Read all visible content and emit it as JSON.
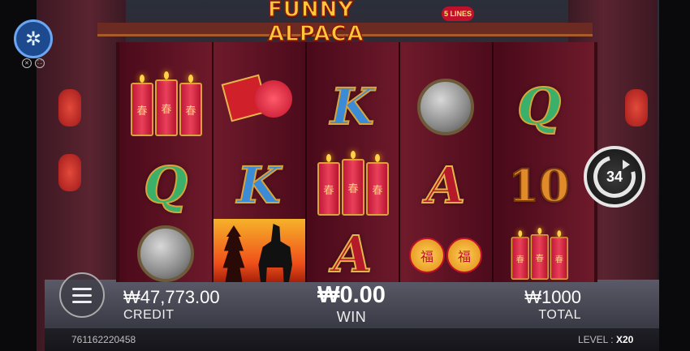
{
  "logo": {
    "title": "FUNNY ALPACA",
    "lines_badge": "5 LINES"
  },
  "controls": {
    "settings_icon": "wheel-icon",
    "spin_count": "34",
    "menu_icon": "menu-icon"
  },
  "reels": [
    {
      "reel": 1,
      "symbols": [
        "firecracker-candles",
        "Q",
        "gong"
      ]
    },
    {
      "reel": 2,
      "symbols": [
        "firecracker-bundle",
        "K",
        "alpaca-sunset"
      ]
    },
    {
      "reel": 3,
      "symbols": [
        "K",
        "firecracker-candles",
        "A"
      ]
    },
    {
      "reel": 4,
      "symbols": [
        "gong",
        "A",
        "lanterns"
      ]
    },
    {
      "reel": 5,
      "symbols": [
        "Q",
        "10",
        "firecracker-candles"
      ]
    }
  ],
  "symbol_text": {
    "q": "Q",
    "k": "K",
    "a": "A",
    "ten": "10",
    "candle_char": "春",
    "lantern_char": "福"
  },
  "stats": {
    "credit_value": "₩47,773.00",
    "credit_label": "CREDIT",
    "win_value": "₩0.00",
    "win_label": "WIN",
    "total_value": "₩1000",
    "total_label": "TOTAL"
  },
  "footer": {
    "session_id": "761162220458",
    "level_label": "LEVEL :",
    "level_value": "X20"
  },
  "colors": {
    "reel_bg": "#6e1a2b",
    "gold": "#e6b54a",
    "q_green": "#3bb06a",
    "k_blue": "#3c8bd6",
    "a_red": "#b51a2a"
  }
}
